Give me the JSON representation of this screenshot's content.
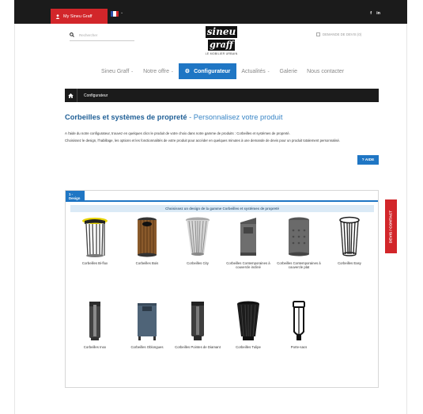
{
  "topbar": {
    "account_label": "My Sineu Graff",
    "social": [
      "f",
      "in"
    ]
  },
  "header": {
    "search_placeholder": "Rechercher",
    "logo_line1": "sineu",
    "logo_line2": "graff",
    "logo_tagline": "LE MOBILIER URBAIN",
    "quote_label": "DEMANDE DE DEVIS (0)"
  },
  "nav": [
    {
      "label": "Sineu Graff",
      "caret": true
    },
    {
      "label": "Notre offre",
      "caret": true
    },
    {
      "label": "Configurateur",
      "active": true
    },
    {
      "label": "Actualités",
      "caret": true
    },
    {
      "label": "Galerie"
    },
    {
      "label": "Nous contacter"
    }
  ],
  "breadcrumb": {
    "current": "Configurateur"
  },
  "page": {
    "title_main": "Corbeilles et systèmes de propreté",
    "title_sep": " - ",
    "title_sub": "Personnalisez votre produit",
    "intro_1": "A l'aide du notre configurateur, trouvez en quelques clics le produit de votre choix dans notre gamme de produits : Corbeilles et systèmes de propreté.",
    "intro_2": "Choisissez le design, l'habillage, les options et les fonctionnalités de votre produit pour accéder en quelques minutes à une demande de devis pour un produit totalement personnalisé.",
    "help_label": "? AIDE"
  },
  "configurator": {
    "step_label": "1 - Design",
    "choose_label": "Choisissez un design de la gamme Corbeilles et systèmes de propreté",
    "products": [
      "Corbeilles Bi-flux",
      "Corbeilles Bois",
      "Corbeilles City",
      "Corbeilles Contemporaines à couvercle incliné",
      "Corbeilles Contemporaines à couvercle plat",
      "Corbeilles Easy",
      "Corbeilles Inox",
      "Corbeilles Oblongues",
      "Corbeilles Pointes de Diamant",
      "Corbeilles Tulipe",
      "Porte-sacs"
    ]
  },
  "side_tab": {
    "label": "DEVIS / CONTACT"
  },
  "colors": {
    "brand_red": "#d2262a",
    "accent_blue": "#1f76c4",
    "dark_bar": "#1b1b1b"
  }
}
